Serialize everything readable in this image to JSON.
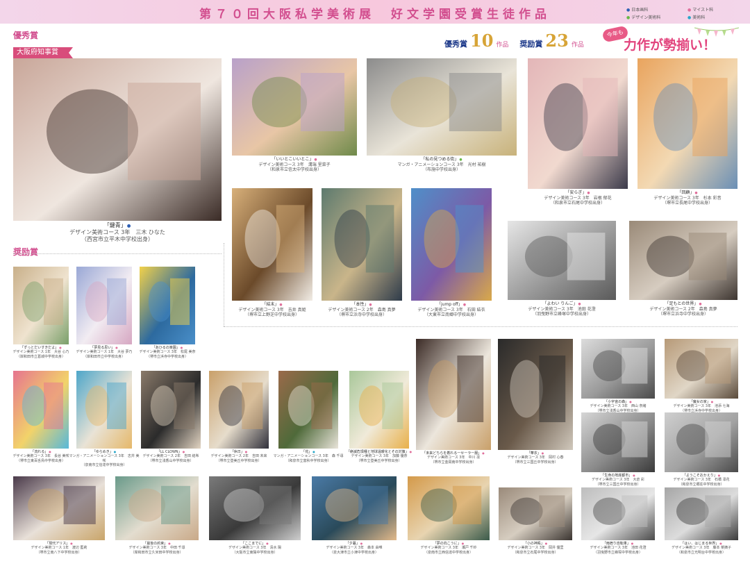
{
  "header": {
    "title": "第７０回大阪私学美術展　好文学園受賞生徒作品",
    "legend": [
      "日本画科",
      "マイスト科",
      "デザイン美術科",
      "美術科"
    ]
  },
  "sections": {
    "excellence": "優秀賞",
    "encouragement": "奨励賞",
    "governor_award": "大阪府知事賞"
  },
  "counts": {
    "excellence_label": "優秀賞",
    "excellence_num": "10",
    "excellence_unit": "作品",
    "encouragement_label": "奨励賞",
    "encouragement_num": "23",
    "encouragement_unit": "作品"
  },
  "banner": {
    "tag": "今年も",
    "text": "力作が勢揃い！"
  },
  "colors": {
    "pink": "#d24f8f",
    "navy": "#1e3a8a",
    "gold": "#d7a437",
    "dot_blue": "#2e5fb4",
    "dot_pink": "#e06f9b",
    "dot_green": "#67b845",
    "dot_cyan": "#27a7c9"
  },
  "works": [
    {
      "title": "「鍵青」",
      "course": "デザイン美術コース 3年　三木 ひなた",
      "school": "（西宮市立平木中学校出身）"
    },
    {
      "title": "「いいとこいいとこ」",
      "course": "デザイン美術コース 3年　溝端 里菜子",
      "school": "（和泉市立信太中学校出身）"
    },
    {
      "title": "「私の見つめる街」",
      "course": "マンガ・アニメーションコース 3年　光村 祐樹",
      "school": "（布施中学校出身）"
    },
    {
      "title": "「安らぎ」",
      "course": "デザイン美術コース 3年　岩根 郁花",
      "school": "（和泉市立石尾中学校出身）"
    },
    {
      "title": "「回顧」",
      "course": "デザイン美術コース 3年　杉本 彩音",
      "school": "（堺市立長尾中学校出身）"
    },
    {
      "title": "「結末」",
      "course": "デザイン美術コース 3年　吉井 真姫",
      "school": "（堺市立上野芝中学校出身）"
    },
    {
      "title": "「本性」",
      "course": "デザイン美術コース 2年　森島 真夢",
      "school": "（堺市立浜寺中学校出身）"
    },
    {
      "title": "「jump off」",
      "course": "デザイン美術コース 3年　石田 結衣",
      "school": "（大東市立南郷中学校出身）"
    },
    {
      "title": "「よわい りんご」",
      "course": "デザイン美術コース 3年　池田 花澄",
      "school": "（羽曳野市立峰塚中学校出身）"
    },
    {
      "title": "「足もとの世界」",
      "course": "デザイン美術コース 2年　森島 真夢",
      "school": "（堺市立浜寺中学校出身）"
    },
    {
      "title": "「ずっとだいすきだよ」",
      "course": "デザイン美術コース 1年　大谷 心乃",
      "school": "（岸和田市立葛城中学校出身）"
    },
    {
      "title": "「夢見る思い」",
      "course": "デザイン美術コース 1年　大谷 夢乃",
      "school": "（岸和田市立中学校出身）"
    },
    {
      "title": "「あひるの楽園」",
      "course": "デザイン美術コース 3年　松尾 美奈",
      "school": "（堺市立浜寺中学校出身）"
    },
    {
      "title": "「流れる」",
      "course": "デザイン美術コース 3年　長谷 美咲",
      "school": "（堺市立東百舌鳥中学校出身）"
    },
    {
      "title": "「ゆらめき」",
      "course": "マンガ・アニメーションコース 3年　志井 美咲",
      "school": "（泉南市立信達中学校出身）"
    },
    {
      "title": "「LL CLOWN」",
      "course": "デザイン美術コース 2年　吉田 結希",
      "school": "（堺市立浅香山中学校出身）"
    },
    {
      "title": "「休日」",
      "course": "デザイン美術コース 2年　吉田 未来",
      "school": "（堺市立登美丘中学校出身）"
    },
    {
      "title": "「花」",
      "course": "マンガ・アニメーションコース 3年　森 千尋",
      "school": "（和泉市立富秋中学校出身）"
    },
    {
      "title": "「絶滅危惧種と地球温暖化とその対策」",
      "course": "デザイン美術コース 3年　加藤 優奈",
      "school": "（堺市立登美丘中学校出身）"
    },
    {
      "title": "「未来どちらを着れるーセーラー服」",
      "course": "デザイン美術コース 3年　中川 凛",
      "school": "（堺市立金岡南中学校出身）"
    },
    {
      "title": "「華衣」",
      "course": "デザイン美術コース 3年　岡村 心春",
      "school": "（堺市立三国丘中学校出身）"
    },
    {
      "title": "「小宇宙の森」",
      "course": "デザイン美術コース 3年　西山 奈緒",
      "school": "（堺市立浅香山中学校出身）"
    },
    {
      "title": "「魔女の家」",
      "course": "デザイン美術コース 3年　池添 七海",
      "school": "（堺市立浜寺中学校出身）"
    },
    {
      "title": "「生命の地底都市」",
      "course": "デザイン美術コース 3年　大倉 彩",
      "school": "（堺市立三国丘中学校出身）"
    },
    {
      "title": "「ようこそおかえり」",
      "course": "デザイン美術コース 3年　石橋 凛花",
      "school": "（和泉市立郷荘中学校出身）"
    },
    {
      "title": "「現代アリス」",
      "course": "デザイン美術コース 1年　渡辺 藍莉",
      "school": "（堺市立南八下中学校出身）"
    },
    {
      "title": "「最後の約束」",
      "course": "デザイン美術コース 3年　中田 千尋",
      "school": "（岸和田市立久米田中学校出身）"
    },
    {
      "title": "「ここまでに」",
      "course": "デザイン美術コース 3年　清水 陽",
      "school": "（大阪市立東陽中学校出身）"
    },
    {
      "title": "「夕暮」",
      "course": "デザイン美術コース 3年　森本 由唯",
      "school": "（泉大津市立小津中学校出身）"
    },
    {
      "title": "「夢の向こうに」",
      "course": "デザイン美術コース 3年　瀬戸 千紗",
      "school": "（泉南市立西信達中学校出身）"
    },
    {
      "title": "「小の神殿」",
      "course": "デザイン美術コース 3年　岡井 優里",
      "school": "（和泉市立石尾中学校出身）"
    },
    {
      "title": "「雨宿り自転車」",
      "course": "デザイン美術コース 3年　池田 花澄",
      "school": "（羽曳野市立峰塚中学校出身）"
    },
    {
      "title": "「はい、はじまる世界」",
      "course": "デザイン美術コース 3年　藤本 菜摘子",
      "school": "（和泉市立光明台中学校出身）"
    }
  ]
}
